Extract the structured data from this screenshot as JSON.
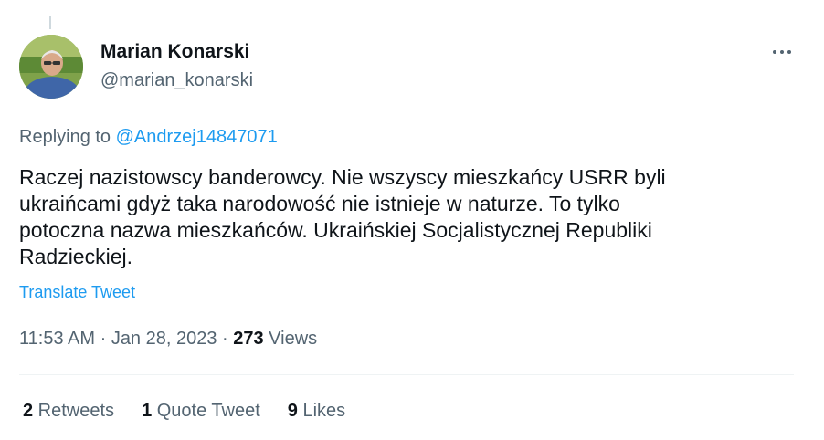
{
  "author": {
    "display_name": "Marian Konarski",
    "handle": "@marian_konarski"
  },
  "reply": {
    "prefix": "Replying to ",
    "mention": "@Andrzej14847071"
  },
  "tweet": {
    "text": "Raczej nazistowscy banderowcy. Nie wszyscy mieszkańcy USRR byli\nukraińcami gdyż taka narodowość nie istnieje w naturze. To tylko\npotoczna nazwa mieszkańców. Ukraińskiej Socjalistycznej Republiki\nRadzieckiej.",
    "translate_label": "Translate Tweet"
  },
  "meta": {
    "time": "11:53 AM",
    "separator": " · ",
    "date": "Jan 28, 2023",
    "views_count": "273",
    "views_label": " Views"
  },
  "stats": {
    "retweets_count": "2",
    "retweets_label": " Retweets",
    "quotes_count": "1",
    "quotes_label": " Quote Tweet",
    "likes_count": "9",
    "likes_label": " Likes"
  },
  "icons": {
    "more": "more-horizontal-icon"
  },
  "colors": {
    "link": "#1d9bf0",
    "secondary_text": "#536471",
    "primary_text": "#0f1419",
    "divider": "#eff3f4"
  }
}
